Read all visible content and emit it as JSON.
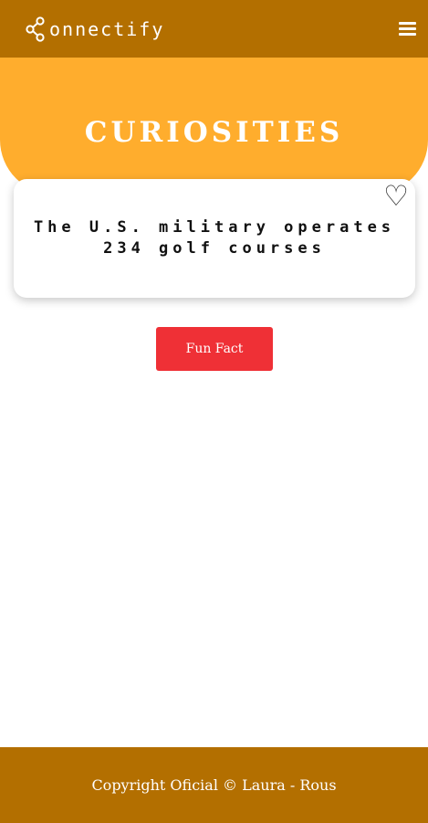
{
  "header": {
    "brand_text": "onnectify",
    "brand_icon": "share-icon",
    "menu_icon": "hamburger-menu-icon",
    "background_color": "#b36f00"
  },
  "hero": {
    "title": "CURIOSITIES",
    "background_color": "#ffad2d"
  },
  "fact_card": {
    "text": "The U.S. military operates 234 golf courses",
    "favorite_icon": "heart-outline-icon",
    "favorite_glyph": "♡"
  },
  "actions": {
    "fun_fact_label": "Fun Fact",
    "button_color": "#ef3036"
  },
  "footer": {
    "text": "Copyright Oficial © Laura - Rous"
  }
}
